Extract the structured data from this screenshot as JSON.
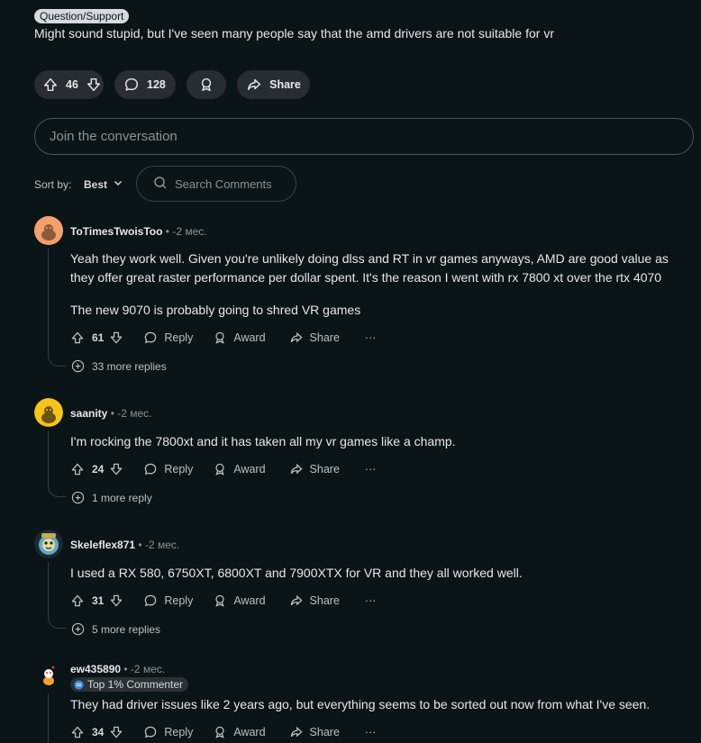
{
  "post": {
    "flair": "Question/Support",
    "body": "Might sound stupid, but I've seen many people say that the amd drivers are not suitable for vr",
    "score": "46",
    "comments_count": "128",
    "share_label": "Share"
  },
  "join_placeholder": "Join the conversation",
  "sort": {
    "label": "Sort by:",
    "value": "Best"
  },
  "search_placeholder": "Search Comments",
  "labels": {
    "reply": "Reply",
    "award": "Award",
    "share": "Share",
    "more": "···"
  },
  "comments": [
    {
      "user": "ToTimesTwoisToo",
      "time": "-2 мес.",
      "paragraphs": [
        "Yeah they work well. Given you're unlikely doing dlss and RT in vr games anyways, AMD are good value as they offer great raster performance per dollar spent. It's the reason I went with rx 7800 xt over the rtx 4070",
        "The new 9070 is probably going to shred VR games"
      ],
      "score": "61",
      "more_replies": "33 more replies"
    },
    {
      "user": "saanity",
      "time": "-2 мес.",
      "paragraphs": [
        "I'm rocking the 7800xt and it has taken all my vr games like a champ."
      ],
      "score": "24",
      "more_replies": "1 more reply"
    },
    {
      "user": "Skeleflex871",
      "time": "-2 мес.",
      "paragraphs": [
        "I used a RX 580, 6750XT, 6800XT and 7900XTX for VR and they all worked well."
      ],
      "score": "31",
      "more_replies": "5 more replies"
    },
    {
      "user": "ew435890",
      "time": "-2 мес.",
      "badge": "Top 1% Commenter",
      "paragraphs": [
        "They had driver issues like 2 years ago, but everything seems to be sorted out now from what I've seen."
      ],
      "score": "34"
    }
  ]
}
